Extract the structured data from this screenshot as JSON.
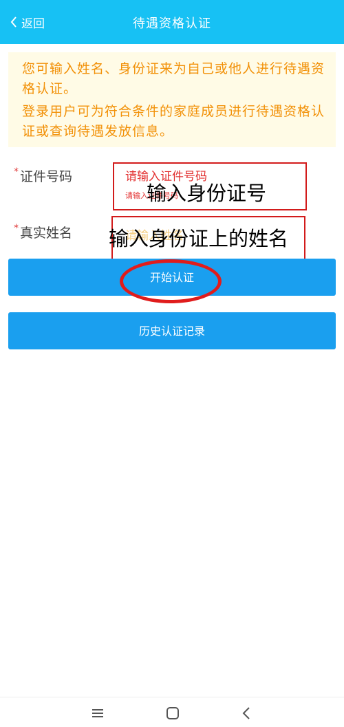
{
  "header": {
    "back_label": "返回",
    "title": "待遇资格认证"
  },
  "notice": {
    "line1": "您可输入姓名、身份证来为自己或他人进行待遇资格认证。",
    "line2": "登录用户可为符合条件的家庭成员进行待遇资格认证或查询待遇发放信息。"
  },
  "form": {
    "required_mark": "*",
    "id_label": "证件号码",
    "id_placeholder": "请输入证件号码",
    "id_sub_placeholder": "请输入证件号码",
    "name_label": "真实姓名",
    "name_placeholder": "请输入姓名"
  },
  "annotations": {
    "id_note": "输入身份证号",
    "name_note": "输入身份证上的姓名"
  },
  "buttons": {
    "start": "开始认证",
    "history": "历史认证记录"
  },
  "navbar": {
    "menu_icon": "menu-icon",
    "home_icon": "home-square-icon",
    "back_icon": "back-chevron-icon"
  },
  "colors": {
    "header_bg": "#17c1f4",
    "notice_bg": "#fffbe6",
    "notice_text": "#f29108",
    "button_bg": "#1a9fef",
    "annotation_red": "#d21b1b"
  }
}
